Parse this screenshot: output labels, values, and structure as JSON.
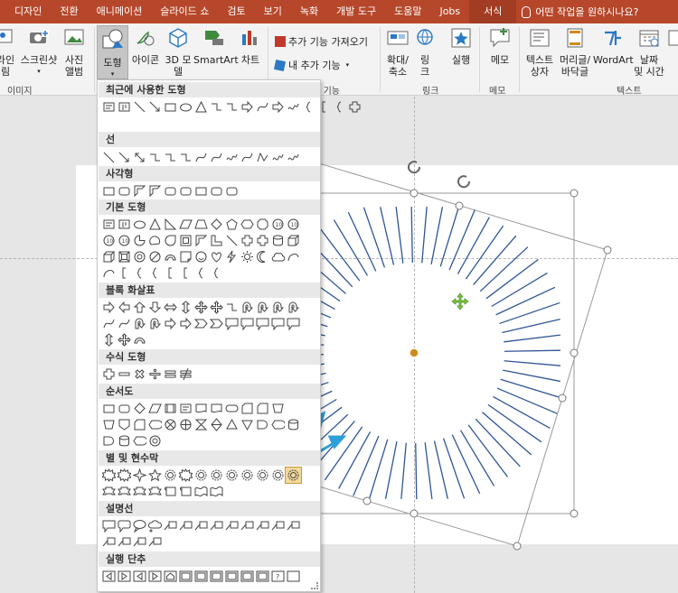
{
  "tabs": [
    "디자인",
    "전환",
    "애니메이션",
    "슬라이드 쇼",
    "검토",
    "보기",
    "녹화",
    "개발 도구",
    "도움말",
    "Jobs",
    "서식"
  ],
  "active_tab": "서식",
  "tell_me": "어떤 작업을 원하시나요?",
  "ribbon": {
    "online_pictures": "라인\n림",
    "screenshot": "스크린샷",
    "photo_album": "사진\n앨범",
    "shapes": "도형",
    "icons": "아이콘",
    "models_3d": "3D 모\n델",
    "smartart": "SmartArt",
    "chart": "차트",
    "get_addins": "추가 기능 가져오기",
    "my_addins": "내 추가 기능",
    "zoom": "확대/\n축소",
    "link": "링\n크",
    "action": "실행",
    "comment": "메모",
    "textbox": "텍스트\n상자",
    "header_footer": "머리글/\n바닥글",
    "wordart": "WordArt",
    "date_time": "날짜\n및 시간",
    "group_images": "이미지",
    "group_addins": "추가 기능",
    "group_links": "링크",
    "group_comments": "메모",
    "group_text": "텍스트"
  },
  "gallery": {
    "sections": [
      "최근에 사용한 도형",
      "선",
      "사각형",
      "기본 도형",
      "블록 화살표",
      "수식 도형",
      "순서도",
      "별 및 현수막",
      "설명선",
      "실행 단추"
    ]
  },
  "colors": {
    "tab_bar": "#b7472a",
    "accent_arrow": "#2e9fd8",
    "shape_stroke": "#2f5596",
    "rotate_handle": "#d08b1a"
  }
}
